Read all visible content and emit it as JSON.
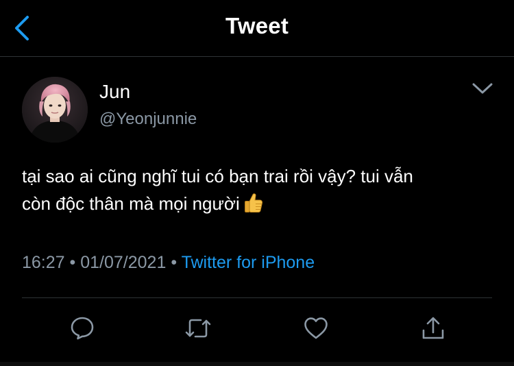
{
  "header": {
    "title": "Tweet",
    "back_icon": "chevron-left-icon",
    "accent_color": "#1d9bf0"
  },
  "tweet": {
    "author": {
      "display_name": "Jun",
      "handle": "@Yeonjunnie"
    },
    "text_lines": [
      "tại sao ai cũng nghĩ tui có bạn trai rồi vậy? tui vẫn",
      "còn độc thân mà mọi người"
    ],
    "emoji": "thumbs-up-icon",
    "time": "16:27",
    "date": "01/07/2021",
    "separator": "•",
    "source": "Twitter for iPhone",
    "more_icon": "chevron-down-icon"
  },
  "actions": [
    {
      "name": "reply",
      "icon": "reply-icon"
    },
    {
      "name": "retweet",
      "icon": "retweet-icon"
    },
    {
      "name": "like",
      "icon": "heart-icon"
    },
    {
      "name": "share",
      "icon": "share-icon"
    }
  ],
  "colors": {
    "background": "#000000",
    "text": "#ffffff",
    "secondary_text": "#8b98a5",
    "link": "#1d9bf0",
    "divider": "#2f3336"
  }
}
